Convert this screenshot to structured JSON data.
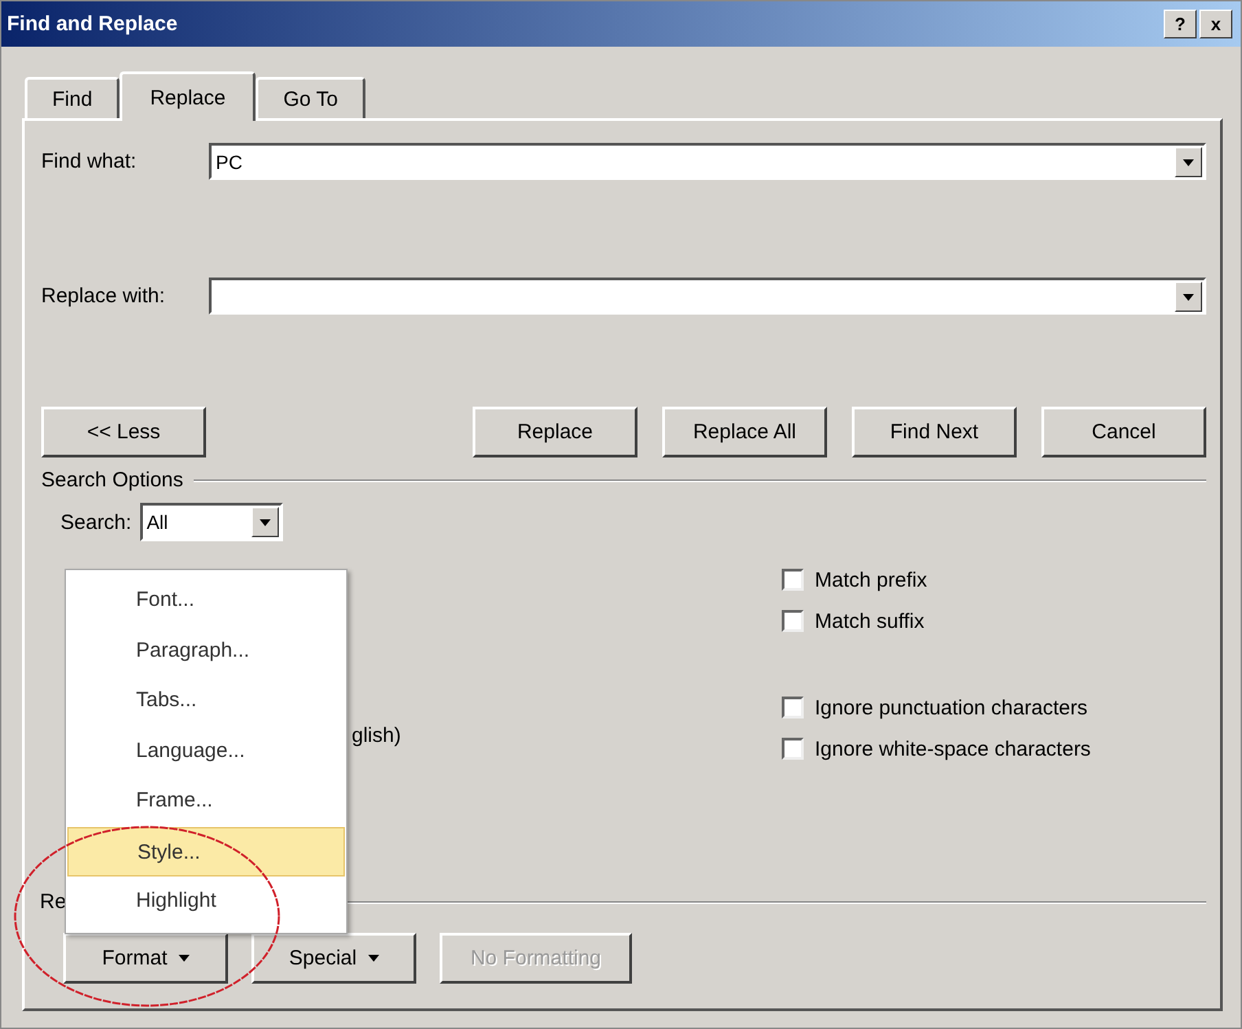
{
  "window": {
    "title": "Find and Replace",
    "title_buttons": [
      "?",
      "x"
    ]
  },
  "tabs": [
    {
      "label": "Find",
      "selected": false
    },
    {
      "label": "Replace",
      "selected": true
    },
    {
      "label": "Go To",
      "selected": false
    }
  ],
  "find_what": {
    "label": "Find what:",
    "value": "PC"
  },
  "replace_with": {
    "label": "Replace with:"
  },
  "less_button": "<< Less",
  "action_buttons": [
    "Replace",
    "Replace All",
    "Find Next",
    "Cancel"
  ],
  "search_options": {
    "title": "Search Options",
    "search_label": "Search:",
    "search_value": "All"
  },
  "options_left_partial": "glish)",
  "options_right": [
    {
      "label": "Match prefix",
      "checked": false
    },
    {
      "label": "Match suffix",
      "checked": false
    },
    {
      "label": "Ignore punctuation characters",
      "checked": false
    },
    {
      "label": "Ignore white-space characters",
      "checked": false
    }
  ],
  "replace_group_partial": "Re",
  "bottom_buttons": [
    {
      "label": "Format",
      "dropdown": true,
      "disabled": false
    },
    {
      "label": "Special",
      "dropdown": true,
      "disabled": false
    },
    {
      "label": "No Formatting",
      "dropdown": false,
      "disabled": true
    }
  ],
  "format_menu": [
    {
      "label": "Font...",
      "selected": false
    },
    {
      "label": "Paragraph...",
      "selected": false
    },
    {
      "label": "Tabs...",
      "selected": false
    },
    {
      "label": "Language...",
      "selected": false
    },
    {
      "label": "Frame...",
      "selected": false
    },
    {
      "label": "Style...",
      "selected": true
    },
    {
      "label": "Highlight",
      "selected": false
    }
  ],
  "annotation": {
    "kind": "ellipse",
    "color": "#d0202a"
  }
}
